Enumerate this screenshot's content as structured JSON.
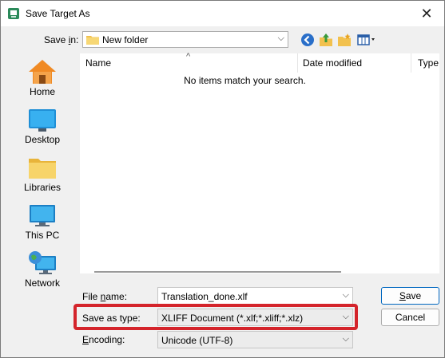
{
  "window": {
    "title": "Save Target As",
    "app_icon": "save-dialog-icon",
    "close_glyph": "✕"
  },
  "toolbar": {
    "save_in_label_prefix": "Save ",
    "save_in_label_key": "i",
    "save_in_label_suffix": "n:",
    "location": "New folder",
    "combo_arrow": "⌵",
    "icons": [
      "back-icon",
      "up-folder-icon",
      "new-folder-icon",
      "view-menu-icon"
    ]
  },
  "places": [
    {
      "label": "Home",
      "icon": "home-icon"
    },
    {
      "label": "Desktop",
      "icon": "desktop-icon"
    },
    {
      "label": "Libraries",
      "icon": "libraries-icon"
    },
    {
      "label": "This PC",
      "icon": "this-pc-icon"
    },
    {
      "label": "Network",
      "icon": "network-icon"
    }
  ],
  "filelist": {
    "columns": [
      "Name",
      "Date modified",
      "Type"
    ],
    "sort_caret": "^",
    "empty_message": "No items match your search."
  },
  "form": {
    "file_name_label_prefix": "File ",
    "file_name_label_key": "n",
    "file_name_label_suffix": "ame:",
    "file_name_value": "Translation_done.xlf",
    "save_as_type_label": "Save as type:",
    "save_as_type_value": "XLIFF Document (*.xlf;*.xliff;*.xlz)",
    "encoding_label_key": "E",
    "encoding_label_suffix": "ncoding:",
    "encoding_value": "Unicode (UTF-8)"
  },
  "buttons": {
    "save_key": "S",
    "save_suffix": "ave",
    "cancel": "Cancel"
  },
  "colors": {
    "highlight": "#d4242b",
    "accent": "#0067c0"
  }
}
